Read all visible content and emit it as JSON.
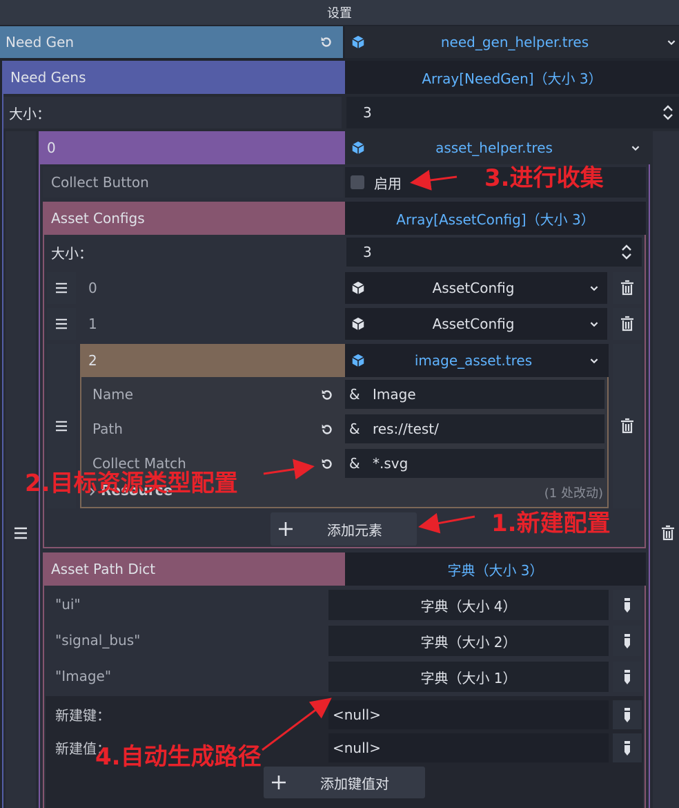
{
  "panel": {
    "title": "设置"
  },
  "need_gen": {
    "label": "Need Gen",
    "value": "need_gen_helper.tres"
  },
  "need_gens": {
    "label": "Need Gens",
    "value": "Array[NeedGen]（大小 3）"
  },
  "size_label": "大小：",
  "size_value": "3",
  "item0": {
    "index": "0",
    "value": "asset_helper.tres",
    "collect_button": {
      "label": "Collect Button",
      "checkbox_label": "启用"
    },
    "asset_configs": {
      "label": "Asset Configs",
      "value": "Array[AssetConfig]（大小 3）",
      "size_label": "大小：",
      "size_value": "3",
      "items": [
        {
          "index": "0",
          "value": "AssetConfig"
        },
        {
          "index": "1",
          "value": "AssetConfig"
        },
        {
          "index": "2",
          "value": "image_asset.tres",
          "props": [
            {
              "label": "Name",
              "prefix": "&",
              "value": "Image"
            },
            {
              "label": "Path",
              "prefix": "&",
              "value": "res://test/"
            },
            {
              "label": "Collect Match",
              "prefix": "&",
              "value": "*.svg"
            }
          ],
          "resource_label": "Resource",
          "changes": "(1 处改动)"
        }
      ],
      "add_button": "添加元素"
    },
    "asset_path_dict": {
      "label": "Asset Path Dict",
      "value": "字典（大小 3）",
      "entries": [
        {
          "key": "\"ui\"",
          "value": "字典（大小 4）"
        },
        {
          "key": "\"signal_bus\"",
          "value": "字典（大小 2）"
        },
        {
          "key": "\"Image\"",
          "value": "字典（大小 1）"
        }
      ],
      "new_key_label": "新建键：",
      "new_key_value": "<null>",
      "new_value_label": "新建值：",
      "new_value_value": "<null>",
      "add_pair_button": "添加键值对"
    }
  },
  "annotations": {
    "a1": "1.新建配置",
    "a2": "2.目标资源类型配置",
    "a3": "3.进行收集",
    "a4": "4.自动生成路径"
  },
  "colors": {
    "need_gen_header": "#4e7aa1",
    "need_gens_header": "#545da6",
    "item0_header": "#7a58a1",
    "asset_configs_header": "#86556f",
    "item2_header": "#7c6757",
    "annotation_red": "#e8222a",
    "resource_blue": "#5fb3ff"
  }
}
